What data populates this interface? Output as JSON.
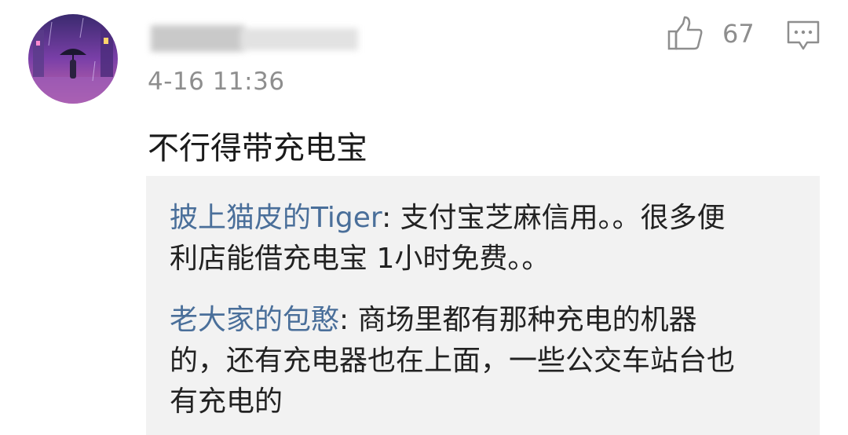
{
  "comment": {
    "timestamp": "4-16 11:36",
    "text": "不行得带充电宝",
    "likes": "67"
  },
  "icons": {
    "like": "thumbs-up-icon",
    "reply": "comment-bubble-icon",
    "avatar": "avatar-umbrella-image"
  },
  "replies": [
    {
      "author": "披上猫皮的Tiger",
      "line1": ": 支付宝芝麻信用。。很多便",
      "line2": "利店能借充电宝 1小时免费。。"
    },
    {
      "author": "老大家的包憨",
      "line1": ": 商场里都有那种充电的机器",
      "line2": "的，还有充电器也在上面，一些公交车站台也",
      "line3": "有充电的"
    }
  ],
  "colors": {
    "author_link": "#4a6f9a",
    "meta_gray": "#8e8e8e",
    "reply_bg": "#f2f2f2"
  }
}
